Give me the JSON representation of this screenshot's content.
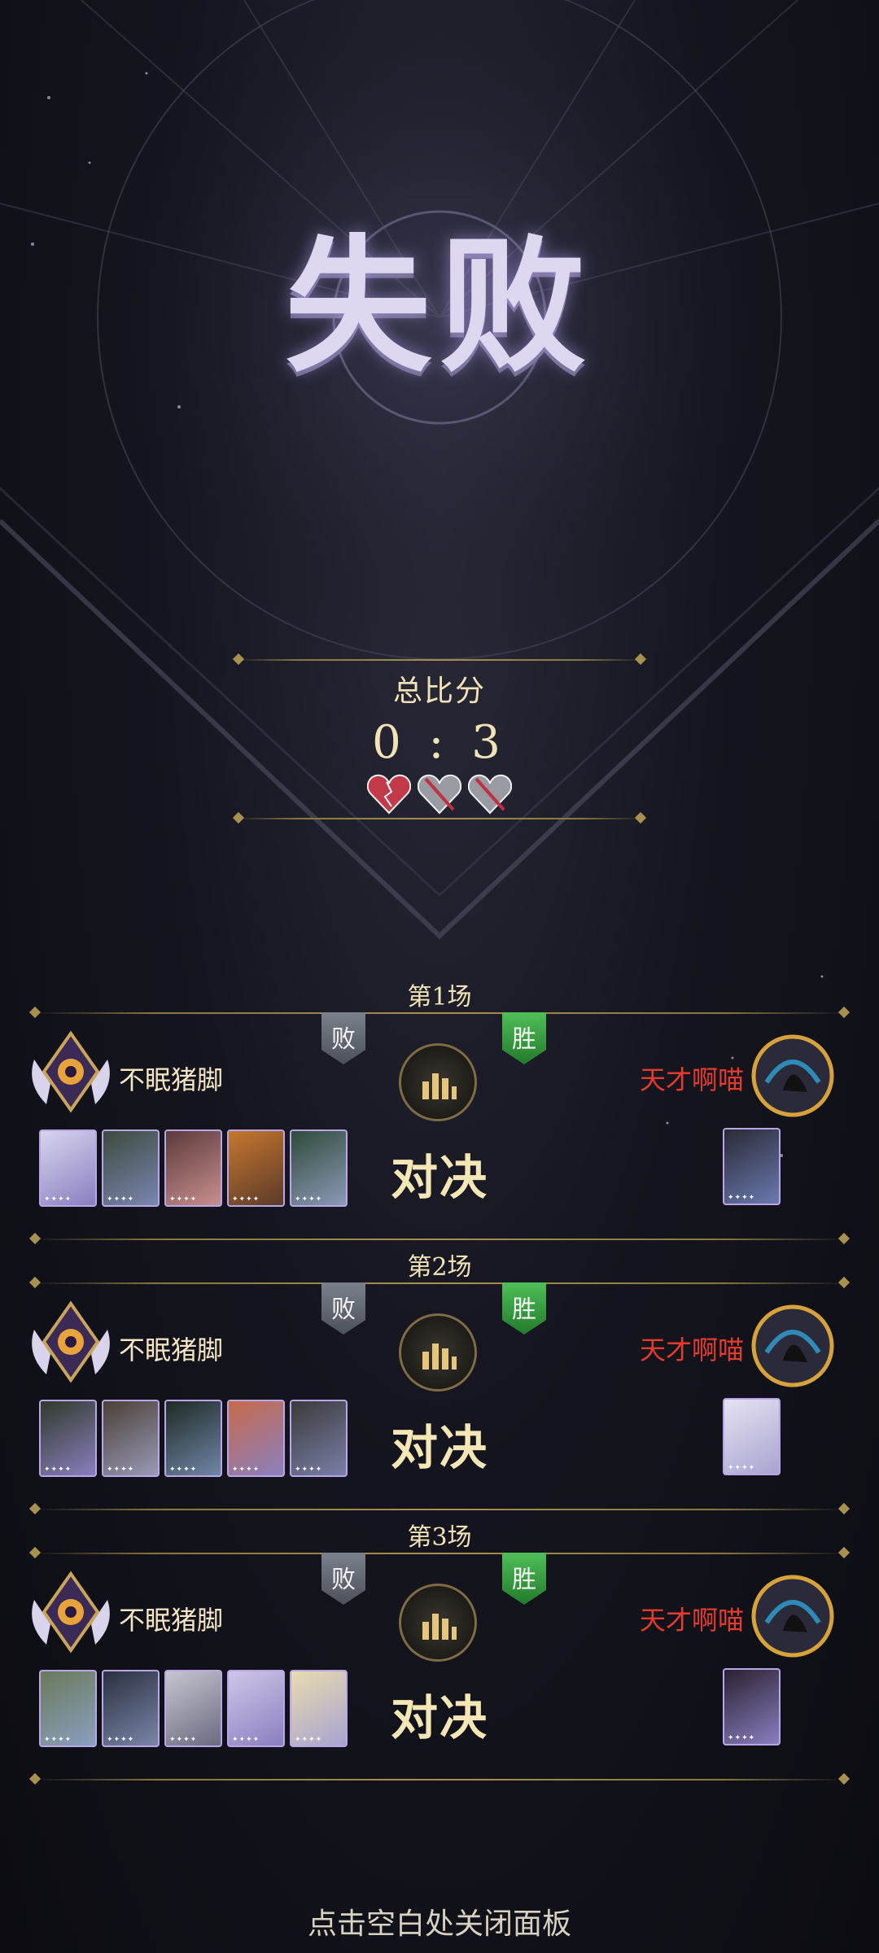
{
  "result": {
    "title": "失败"
  },
  "summary": {
    "label": "总比分",
    "score": "0 : 3",
    "hearts": [
      "heart-won-icon",
      "heart-lost-icon",
      "heart-lost-icon"
    ]
  },
  "matches": [
    {
      "title": "第1场",
      "left_status": "败",
      "right_status": "胜",
      "player_name": "不眠猪脚",
      "opponent_name": "天才啊喵",
      "vs_label": "对决",
      "player_cards": 5,
      "opponent_cards": 1
    },
    {
      "title": "第2场",
      "left_status": "败",
      "right_status": "胜",
      "player_name": "不眠猪脚",
      "opponent_name": "天才啊喵",
      "vs_label": "对决",
      "player_cards": 5,
      "opponent_cards": 1
    },
    {
      "title": "第3场",
      "left_status": "败",
      "right_status": "胜",
      "player_name": "不眠猪脚",
      "opponent_name": "天才啊喵",
      "vs_label": "对决",
      "player_cards": 5,
      "opponent_cards": 1
    }
  ],
  "footer": {
    "hint": "点击空白处关闭面板"
  },
  "colors": {
    "gold": "#f1e3b6",
    "lose": "#6b707a",
    "win": "#3aa044",
    "opponent": "#e33b2e"
  }
}
